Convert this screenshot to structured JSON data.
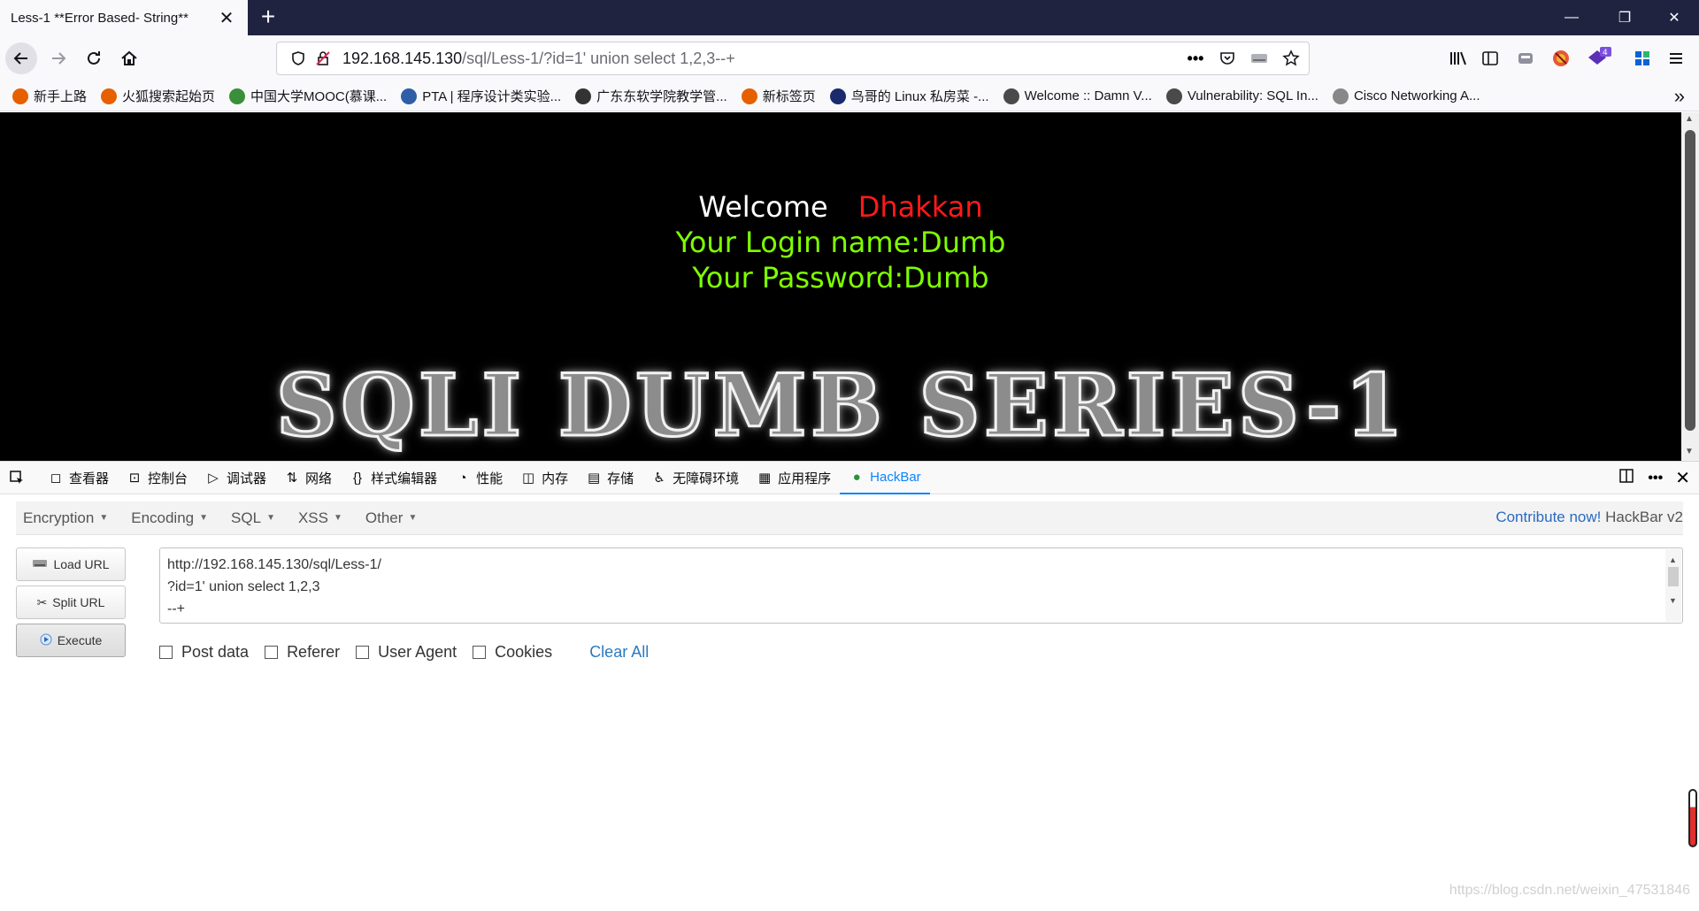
{
  "browser": {
    "tab_title": "Less-1 **Error Based- String**",
    "url_host": "192.168.145.130",
    "url_path": "/sql/Less-1/?id=1' union select 1,2,3--+"
  },
  "bookmarks": [
    {
      "label": "新手上路",
      "color": "#e66000"
    },
    {
      "label": "火狐搜索起始页",
      "color": "#e66000"
    },
    {
      "label": "中国大学MOOC(慕课...",
      "color": "#3a8f3a"
    },
    {
      "label": "PTA | 程序设计类实验...",
      "color": "#2f5ea8"
    },
    {
      "label": "广东东软学院教学管...",
      "color": "#333333"
    },
    {
      "label": "新标签页",
      "color": "#e66000"
    },
    {
      "label": "鸟哥的 Linux 私房菜 -...",
      "color": "#1a2a6c"
    },
    {
      "label": "Welcome :: Damn V...",
      "color": "#4a4a4a"
    },
    {
      "label": "Vulnerability: SQL In...",
      "color": "#4a4a4a"
    },
    {
      "label": "Cisco Networking A...",
      "color": "#888888"
    }
  ],
  "page": {
    "welcome": "Welcome",
    "user": "Dhakkan",
    "login_line": "Your Login name:Dumb",
    "password_line": "Your Password:Dumb",
    "banner": "SQLI DUMB SERIES-1"
  },
  "devtools": {
    "tabs": [
      {
        "label": "查看器",
        "icon": "inspector-icon"
      },
      {
        "label": "控制台",
        "icon": "console-icon"
      },
      {
        "label": "调试器",
        "icon": "debugger-icon"
      },
      {
        "label": "网络",
        "icon": "network-icon"
      },
      {
        "label": "样式编辑器",
        "icon": "style-editor-icon"
      },
      {
        "label": "性能",
        "icon": "performance-icon"
      },
      {
        "label": "内存",
        "icon": "memory-icon"
      },
      {
        "label": "存储",
        "icon": "storage-icon"
      },
      {
        "label": "无障碍环境",
        "icon": "accessibility-icon"
      },
      {
        "label": "应用程序",
        "icon": "application-icon"
      },
      {
        "label": "HackBar",
        "icon": "hackbar-icon"
      }
    ]
  },
  "hackbar": {
    "menu": [
      "Encryption",
      "Encoding",
      "SQL",
      "XSS",
      "Other"
    ],
    "contribute": "Contribute now!",
    "version": "HackBar v2",
    "load_url": "Load URL",
    "split_url": "Split URL",
    "execute": "Execute",
    "url_lines": [
      "http://192.168.145.130/sql/Less-1/",
      "?id=1' union select 1,2,3",
      "--+"
    ],
    "options": [
      "Post data",
      "Referer",
      "User Agent",
      "Cookies"
    ],
    "clear_all": "Clear All"
  },
  "watermark": "https://blog.csdn.net/weixin_47531846",
  "colors": {
    "titlebar": "#202340",
    "accent": "#0a84ff",
    "welcome_user": "#ff1a1a",
    "green_text": "#7fff00"
  }
}
